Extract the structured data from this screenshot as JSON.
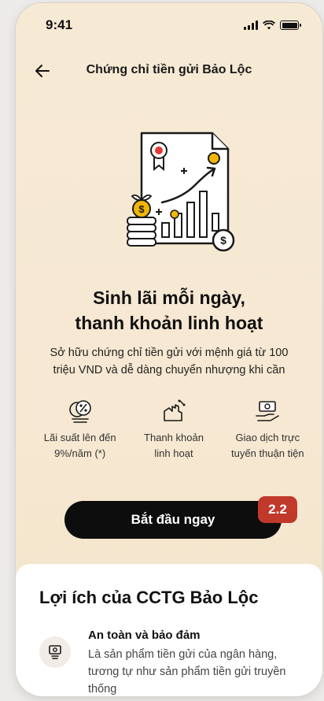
{
  "status_bar": {
    "time": "9:41"
  },
  "nav": {
    "title": "Chứng chỉ tiền gửi Bảo Lộc",
    "back_icon": "arrow-left-icon"
  },
  "hero": {
    "headline_line1": "Sinh lãi mỗi ngày,",
    "headline_line2": "thanh khoản linh hoạt",
    "subtitle": "Sở hữu chứng chỉ tiền gửi với mệnh giá từ 100 triệu VND và dễ dàng chuyển nhượng khi cần"
  },
  "features": [
    {
      "icon": "percent-coin-icon",
      "line1": "Lãi suất lên đến",
      "line2": "9%/năm (*)"
    },
    {
      "icon": "hand-percent-icon",
      "line1": "Thanh khoản",
      "line2": "linh hoạt"
    },
    {
      "icon": "money-transfer-icon",
      "line1": "Giao dịch trực",
      "line2": "tuyến thuận tiện"
    }
  ],
  "cta": {
    "label": "Bắt đầu ngay"
  },
  "annotation_badge": "2.2",
  "benefits": {
    "title": "Lợi ích của CCTG Bảo Lộc",
    "items": [
      {
        "icon": "certificate-icon",
        "title": "An toàn và bảo đảm",
        "desc": "Là sản phẩm tiền gửi của ngân hàng, tương tự như sản phẩm tiền gửi truyền thống"
      }
    ]
  },
  "colors": {
    "accent_red": "#c0392b",
    "cta_bg": "#0d0d0d",
    "hero_bg": "#f7ead5",
    "coin_gold": "#f2b705"
  }
}
